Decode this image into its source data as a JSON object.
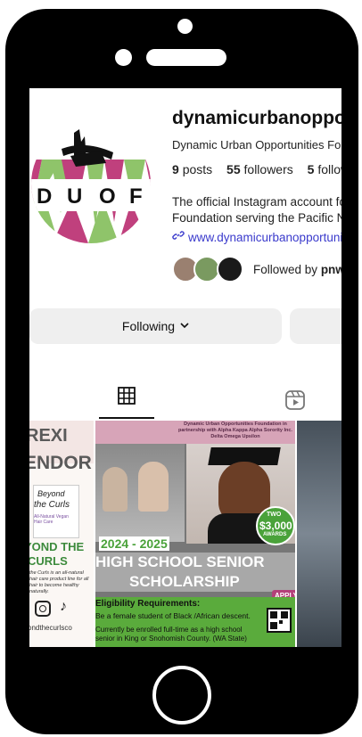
{
  "profile": {
    "username": "dynamicurbanopportunities",
    "full_name": "Dynamic Urban Opportunities Foundation",
    "posts_count": "9",
    "posts_label": "posts",
    "followers_count": "55",
    "followers_label": "followers",
    "following_count": "5",
    "following_label": "following",
    "bio_line1": "The official Instagram account for the Dynamic Urban Opportunities",
    "bio_line2": "Foundation serving the Pacific Northwest",
    "website": "www.dynamicurbanopportunities.org",
    "followed_by_prefix": "Followed by",
    "followed_by_name": "pnw",
    "avatar_letters": [
      "D",
      "U",
      "O",
      "F"
    ]
  },
  "buttons": {
    "following_label": "Following"
  },
  "posts": {
    "left": {
      "line1": "REXI",
      "line2": "ENDOR",
      "logo_line1": "Beyond",
      "logo_line2": "the Curls",
      "logo_sub": "All-Natural Vegan Hair Care",
      "title_line1": "YOND THE",
      "title_line2": "CURLS",
      "desc": "the Curls is an all-natural hair care product line for all hair to become healthy naturally.",
      "handle": "ondthecurlsco"
    },
    "main": {
      "header": "Dynamic Urban Opportunities Foundation in partnership with Alpha Kappa Alpha Sorority Inc. Delta Omega Upsilon",
      "years": "2024 - 2025",
      "title_line1": "HIGH SCHOOL SENIOR",
      "title_line2": "SCHOLARSHIP",
      "badge_line1": "TWO",
      "badge_amount": "$3,000",
      "badge_line2": "AWARDS",
      "apply": "APPLY",
      "req_title": "Eligibility Requirements:",
      "req1": "Be a female student of Black /African descent.",
      "req2": "Currently be enrolled full-time as a high school senior in King or Snohomish County. (WA State)"
    }
  },
  "colors": {
    "pink": "#c0407d",
    "green": "#8fc46a",
    "accent_green": "#5aab3c",
    "link": "#3a3acc"
  },
  "icons": {
    "grid": "grid-icon",
    "reels": "reels-icon",
    "link": "link-icon",
    "chevron": "chevron-down-icon"
  }
}
